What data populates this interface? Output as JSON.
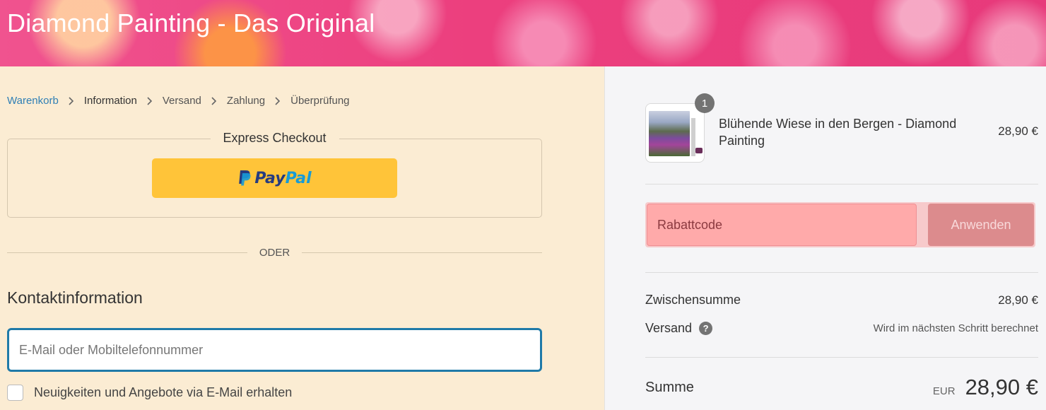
{
  "header": {
    "title": "Diamond Painting - Das Original"
  },
  "breadcrumb": {
    "items": [
      {
        "label": "Warenkorb"
      },
      {
        "label": "Information"
      },
      {
        "label": "Versand"
      },
      {
        "label": "Zahlung"
      },
      {
        "label": "Überprüfung"
      }
    ]
  },
  "express_checkout": {
    "title": "Express Checkout",
    "paypal": {
      "part1": "Pay",
      "part2": "Pal"
    }
  },
  "divider": {
    "text": "ODER"
  },
  "contact": {
    "heading": "Kontaktinformation",
    "email_placeholder": "E-Mail oder Mobiltelefonnummer",
    "newsletter_label": "Neuigkeiten und Angebote via E-Mail erhalten"
  },
  "order_summary": {
    "product": {
      "quantity": "1",
      "name": "Blühende Wiese in den Bergen - Diamond Painting",
      "price": "28,90 €"
    },
    "coupon": {
      "placeholder": "Rabattcode",
      "apply_label": "Anwenden"
    },
    "subtotal": {
      "label": "Zwischensumme",
      "value": "28,90 €"
    },
    "shipping": {
      "label": "Versand",
      "value": "Wird im nächsten Schritt berechnet"
    },
    "total": {
      "label": "Summe",
      "currency": "EUR",
      "value": "28,90 €"
    }
  },
  "colors": {
    "link": "#2f7fb5",
    "left_bg": "#fbecd3",
    "right_bg": "#f5f5f7",
    "paypal_yellow": "#ffc439",
    "focus_border": "#1f7aa8"
  }
}
